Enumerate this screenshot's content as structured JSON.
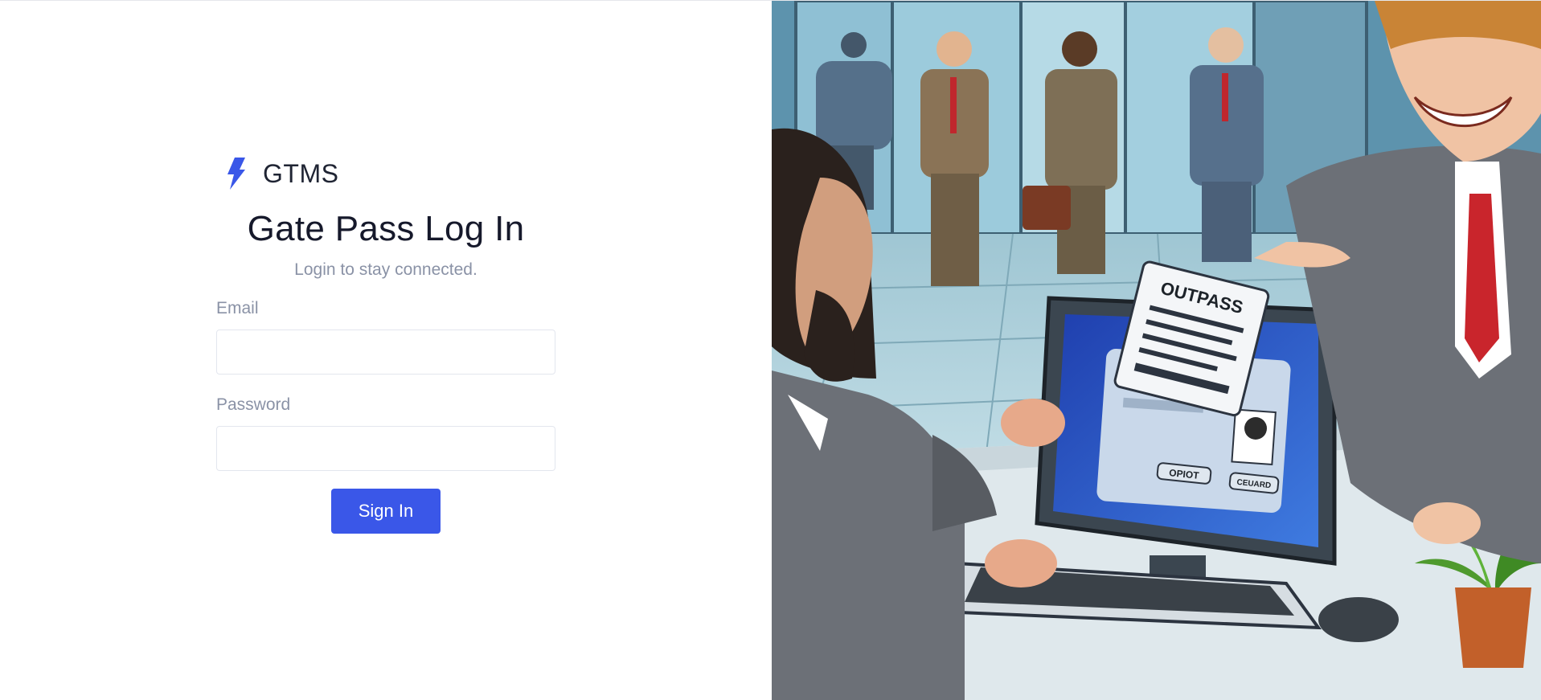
{
  "brand": {
    "name": "GTMS",
    "icon": "lightning-bolt-icon",
    "accent": "#3a57e8"
  },
  "login": {
    "title": "Gate Pass Log In",
    "subtitle": "Login to stay connected.",
    "email_label": "Email",
    "email_value": "",
    "password_label": "Password",
    "password_value": "",
    "submit_label": "Sign In"
  },
  "illustration": {
    "pass_text": "OUTPASS",
    "screen_button_1": "OPIOT",
    "screen_button_2": "CEUARD"
  }
}
